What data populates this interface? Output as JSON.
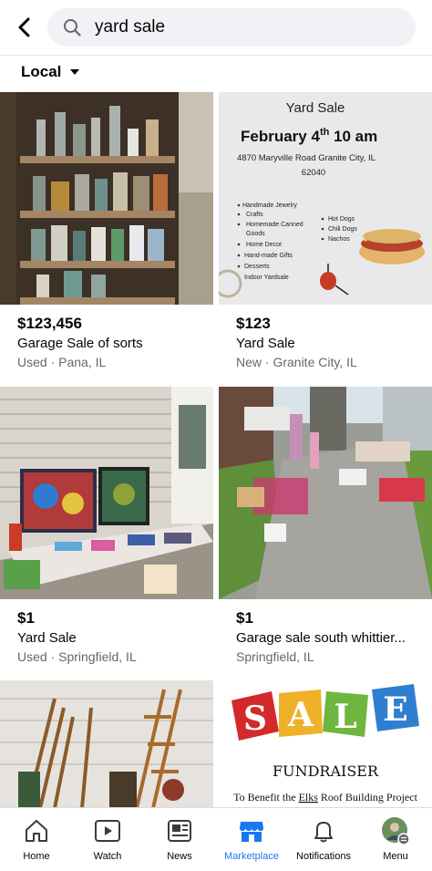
{
  "search": {
    "query": "yard sale"
  },
  "filter": {
    "location_label": "Local"
  },
  "listings": [
    {
      "price": "$123,456",
      "title": "Garage Sale of sorts",
      "subtitle": "Used · Pana, IL"
    },
    {
      "price": "$123",
      "title": "Yard Sale",
      "subtitle": "New · Granite City, IL",
      "flyer": {
        "heading": "Yard Sale",
        "date_main": "February 4",
        "date_sup": "th",
        "time": " 10 am",
        "address": "4870 Maryville Road Granite City, IL",
        "zip": "62040",
        "items_left": [
          "Handmade Jewelry",
          "Crafts",
          "Homemade Canned",
          "Goods",
          "Home Decor",
          "Hand-made Gifts",
          "Desserts",
          "Indoor Yardsale"
        ],
        "items_right": [
          "Hot Dogs",
          "Chili Dogs",
          "Nachos"
        ]
      }
    },
    {
      "price": "$1",
      "title": "Yard Sale",
      "subtitle": "Used · Springfield, IL"
    },
    {
      "price": "$1",
      "title": "Garage sale south whittier...",
      "subtitle": "Springfield, IL"
    },
    {
      "price": "",
      "title": "",
      "subtitle": ""
    },
    {
      "price": "",
      "title": "",
      "subtitle": "",
      "flyer": {
        "sale_letters": [
          "S",
          "A",
          "L",
          "E"
        ],
        "heading": "FUNDRAISER",
        "benefit_pre": "To Benefit the ",
        "benefit_link": "Elks",
        "benefit_post": " Roof Building Project"
      }
    }
  ],
  "tabs": [
    {
      "label": "Home",
      "icon": "home-icon"
    },
    {
      "label": "Watch",
      "icon": "watch-icon"
    },
    {
      "label": "News",
      "icon": "news-icon"
    },
    {
      "label": "Marketplace",
      "icon": "marketplace-icon"
    },
    {
      "label": "Notifications",
      "icon": "bell-icon"
    },
    {
      "label": "Menu",
      "icon": "avatar-menu-icon"
    }
  ],
  "colors": {
    "accent": "#1877f2",
    "search_bg": "#f0f2f5",
    "secondary_text": "#65676b"
  }
}
